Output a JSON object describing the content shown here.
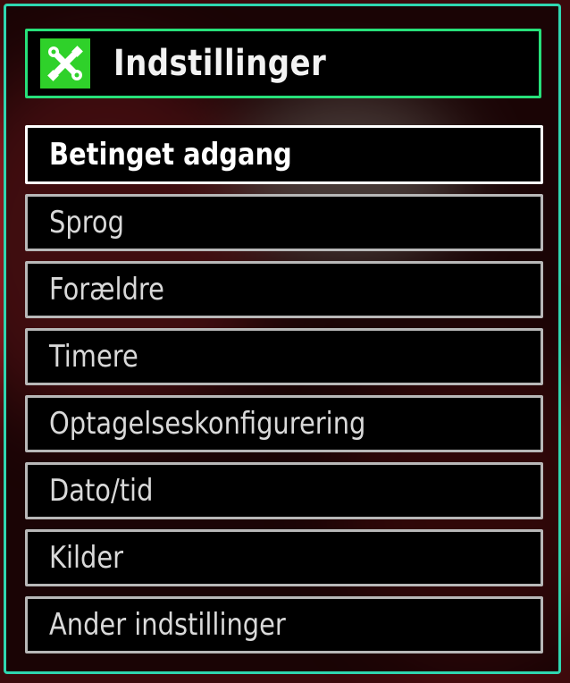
{
  "header": {
    "title": "Indstillinger",
    "icon": "tools-icon",
    "icon_color": "#2fd12a"
  },
  "menu": {
    "items": [
      {
        "label": "Betinget adgang",
        "selected": true
      },
      {
        "label": "Sprog"
      },
      {
        "label": "Forældre"
      },
      {
        "label": "Timere"
      },
      {
        "label": "Optagelseskonfigurering"
      },
      {
        "label": "Dato/tid"
      },
      {
        "label": "Kilder"
      },
      {
        "label": "Ander indstillinger"
      }
    ]
  },
  "colors": {
    "frame_border": "#2fd6b0",
    "header_border": "#27e07a",
    "item_border": "#b8b8b8",
    "selected_border": "#ffffff"
  }
}
